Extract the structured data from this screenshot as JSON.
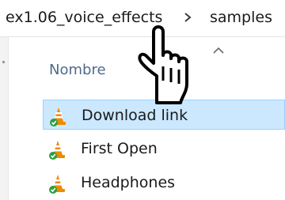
{
  "breadcrumb": {
    "folder": "ex1.06_voice_effects",
    "current": "samples"
  },
  "columns": {
    "name_header": "Nombre"
  },
  "files": [
    {
      "label": "Download link",
      "selected": true,
      "icon": "vlc-cone-icon"
    },
    {
      "label": "First Open",
      "selected": false,
      "icon": "vlc-cone-icon"
    },
    {
      "label": "Headphones",
      "selected": false,
      "icon": "vlc-cone-icon"
    }
  ],
  "colors": {
    "selection_bg": "#cce8ff",
    "selection_border": "#99d1ff",
    "header_text": "#4d6b8a",
    "vlc_orange": "#f08a00"
  },
  "cursor": "hand-pointer-icon"
}
